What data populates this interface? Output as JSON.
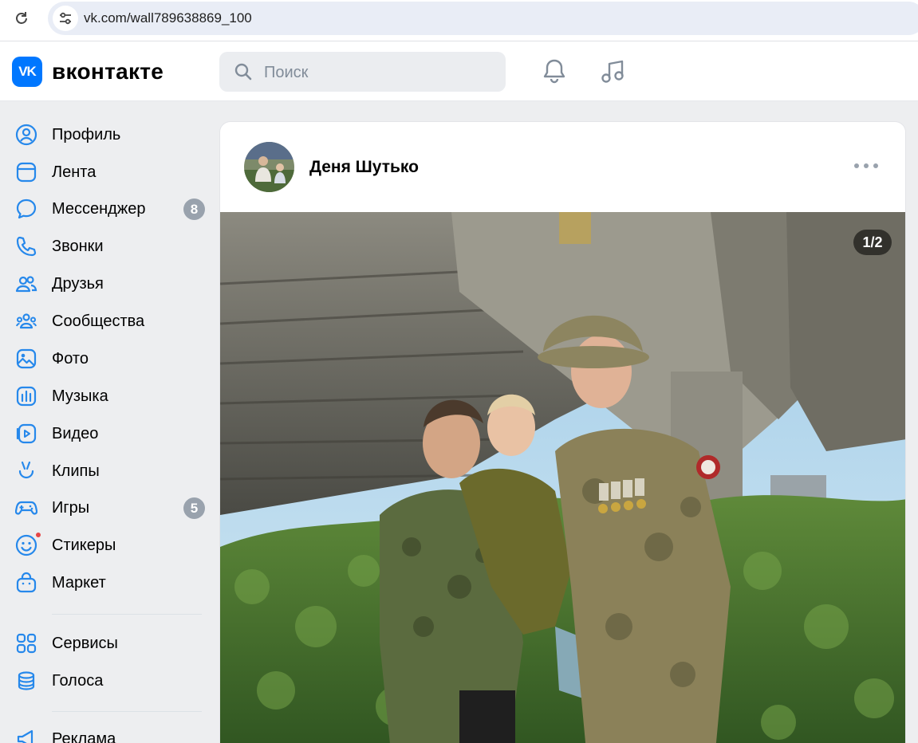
{
  "browser": {
    "url": "vk.com/wall789638869_100"
  },
  "header": {
    "logo_mark": "VK",
    "logo_text": "вконтакте",
    "search_placeholder": "Поиск"
  },
  "sidebar": {
    "items": [
      {
        "label": "Профиль",
        "icon": "profile-icon"
      },
      {
        "label": "Лента",
        "icon": "feed-icon"
      },
      {
        "label": "Мессенджер",
        "icon": "messenger-icon",
        "counter": "8"
      },
      {
        "label": "Звонки",
        "icon": "phone-icon"
      },
      {
        "label": "Друзья",
        "icon": "friends-icon"
      },
      {
        "label": "Сообщества",
        "icon": "communities-icon"
      },
      {
        "label": "Фото",
        "icon": "photo-icon"
      },
      {
        "label": "Музыка",
        "icon": "music-icon"
      },
      {
        "label": "Видео",
        "icon": "video-icon"
      },
      {
        "label": "Клипы",
        "icon": "clips-icon"
      },
      {
        "label": "Игры",
        "icon": "games-icon",
        "counter": "5"
      },
      {
        "label": "Стикеры",
        "icon": "stickers-icon"
      },
      {
        "label": "Маркет",
        "icon": "market-icon"
      },
      {
        "label": "Сервисы",
        "icon": "services-icon"
      },
      {
        "label": "Голоса",
        "icon": "votes-icon"
      },
      {
        "label": "Реклама",
        "icon": "ads-icon"
      }
    ]
  },
  "post": {
    "author": "Деня Шутько",
    "photo_counter": "1/2"
  },
  "colors": {
    "accent": "#0077ff",
    "background": "#edeef0",
    "counter": "#99a2ad",
    "notification_dot": "#e64646"
  }
}
